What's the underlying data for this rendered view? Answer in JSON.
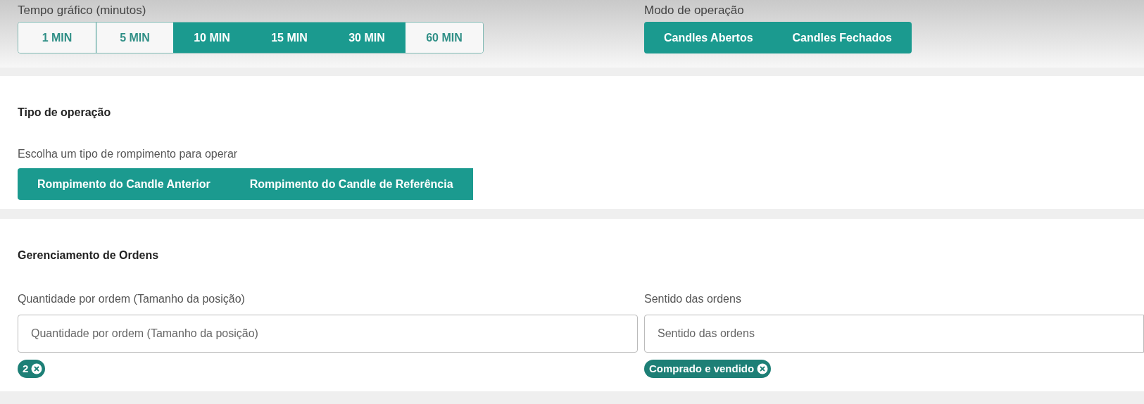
{
  "timeframe": {
    "label": "Tempo gráfico (minutos)",
    "options": [
      {
        "label": "1 MIN",
        "selected": false
      },
      {
        "label": "5 MIN",
        "selected": false
      },
      {
        "label": "10 MIN",
        "selected": true
      },
      {
        "label": "15 MIN",
        "selected": true
      },
      {
        "label": "30 MIN",
        "selected": true
      },
      {
        "label": "60 MIN",
        "selected": false
      }
    ]
  },
  "mode": {
    "label": "Modo de operação",
    "options": [
      {
        "label": "Candles Abertos",
        "selected": true
      },
      {
        "label": "Candles Fechados",
        "selected": true
      }
    ]
  },
  "operation_type": {
    "title": "Tipo de operação",
    "label": "Escolha um tipo de rompimento para operar",
    "options": [
      {
        "label": "Rompimento do Candle Anterior",
        "selected": true
      },
      {
        "label": "Rompimento do Candle de Referência",
        "selected": true
      }
    ]
  },
  "orders": {
    "title": "Gerenciamento de Ordens",
    "fields": [
      {
        "label": "Quantidade por ordem (Tamanho da posição)",
        "placeholder": "Quantidade por ordem (Tamanho da posição)",
        "chips": [
          "2"
        ]
      },
      {
        "label": "Sentido das ordens",
        "placeholder": "Sentido das ordens",
        "chips": [
          "Comprado e vendido"
        ]
      }
    ]
  }
}
